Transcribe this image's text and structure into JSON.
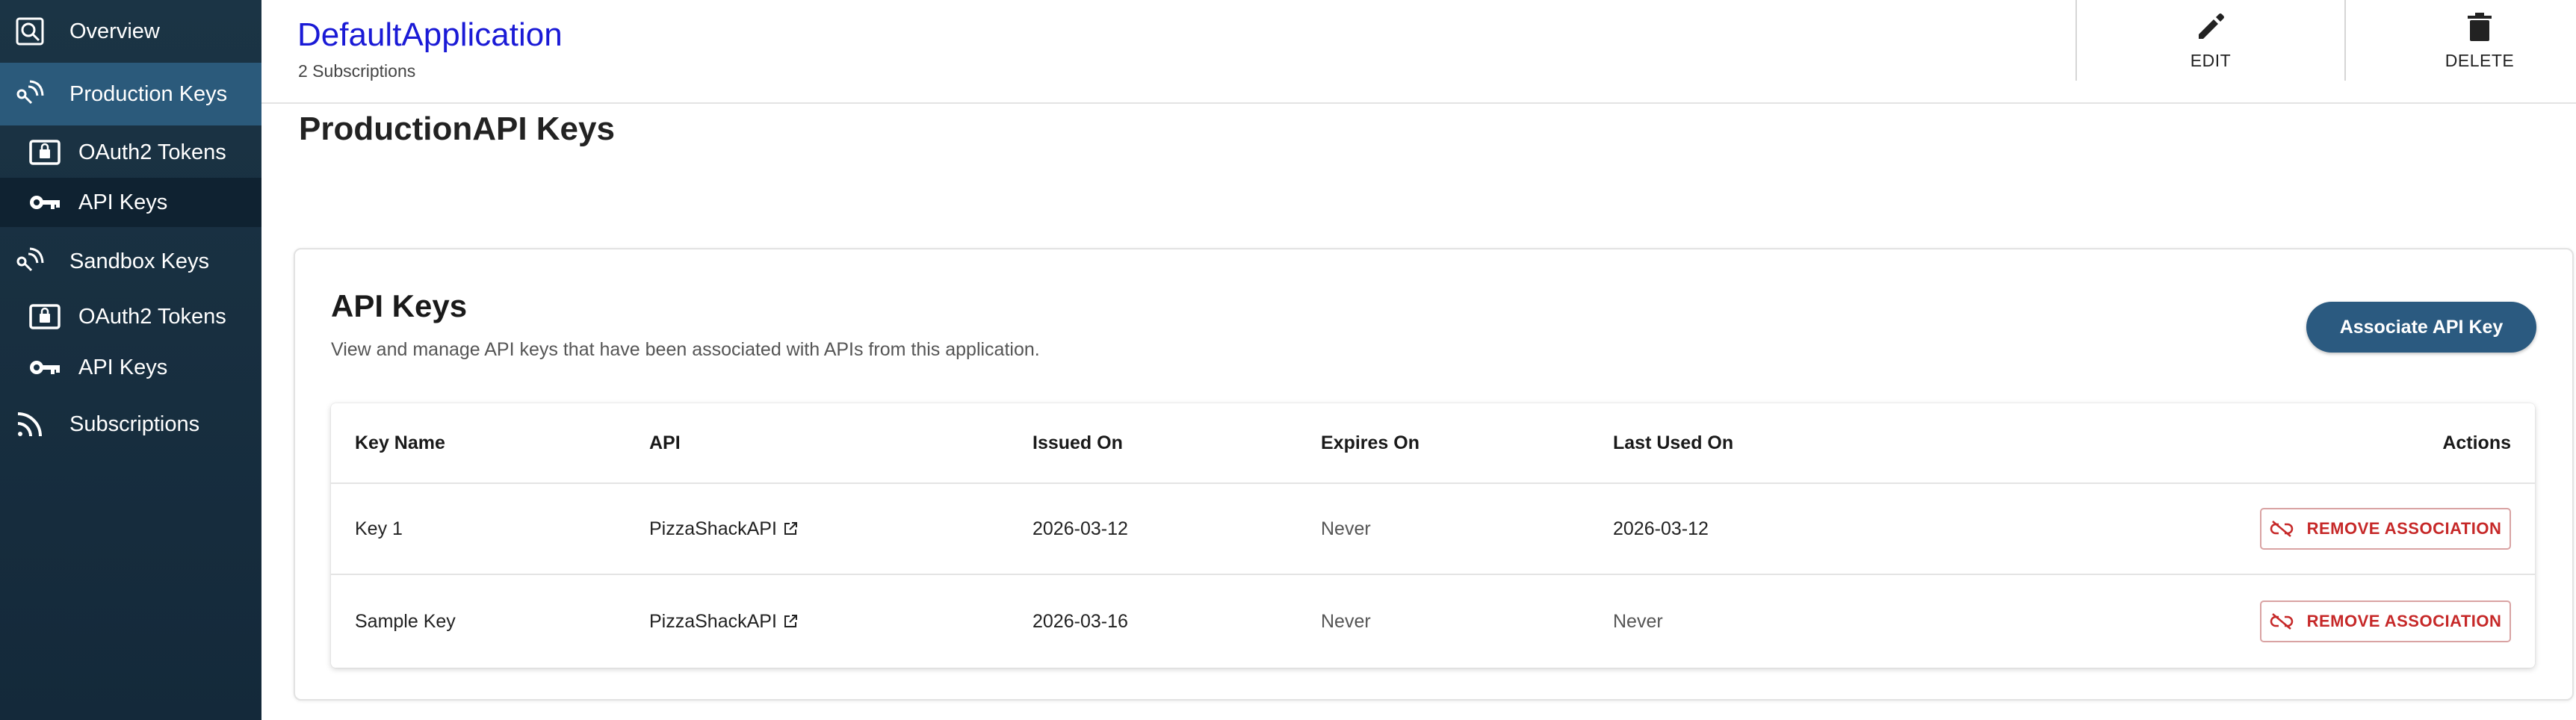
{
  "sidebar": {
    "overview": "Overview",
    "production_keys": "Production Keys",
    "production_oauth2": "OAuth2 Tokens",
    "production_api_keys": "API Keys",
    "sandbox_keys": "Sandbox Keys",
    "sandbox_oauth2": "OAuth2 Tokens",
    "sandbox_api_keys": "API Keys",
    "subscriptions": "Subscriptions"
  },
  "header": {
    "title": "DefaultApplication",
    "subtitle": "2 Subscriptions",
    "edit_label": "EDIT",
    "delete_label": "DELETE"
  },
  "page_heading": "ProductionAPI Keys",
  "card": {
    "title": "API Keys",
    "description": "View and manage API keys that have been associated with APIs from this application.",
    "associate_button": "Associate API Key"
  },
  "table": {
    "columns": {
      "key_name": "Key Name",
      "api": "API",
      "issued_on": "Issued On",
      "expires_on": "Expires On",
      "last_used_on": "Last Used On",
      "actions": "Actions"
    },
    "rows": [
      {
        "key_name": "Key 1",
        "api": "PizzaShackAPI",
        "issued_on": "2026-03-12",
        "expires_on": "Never",
        "last_used_on": "2026-03-12",
        "action": "REMOVE ASSOCIATION"
      },
      {
        "key_name": "Sample Key",
        "api": "PizzaShackAPI",
        "issued_on": "2026-03-16",
        "expires_on": "Never",
        "last_used_on": "Never",
        "action": "REMOVE ASSOCIATION"
      }
    ]
  },
  "colors": {
    "sidebar_bg": "#1b3445",
    "sidebar_active_section": "#2b5a7b",
    "sidebar_active_item": "#0f2231",
    "primary_button": "#2b5a80",
    "title_link": "#1a1ad6",
    "danger": "#c62828"
  },
  "icons": {
    "overview": "overview-icon",
    "production_keys": "keys-signal-icon",
    "oauth2": "lock-card-icon",
    "api_keys": "key-icon",
    "subscriptions": "rss-icon",
    "edit": "pencil-icon",
    "delete": "trash-icon",
    "external": "external-link-icon",
    "remove": "link-off-icon"
  }
}
